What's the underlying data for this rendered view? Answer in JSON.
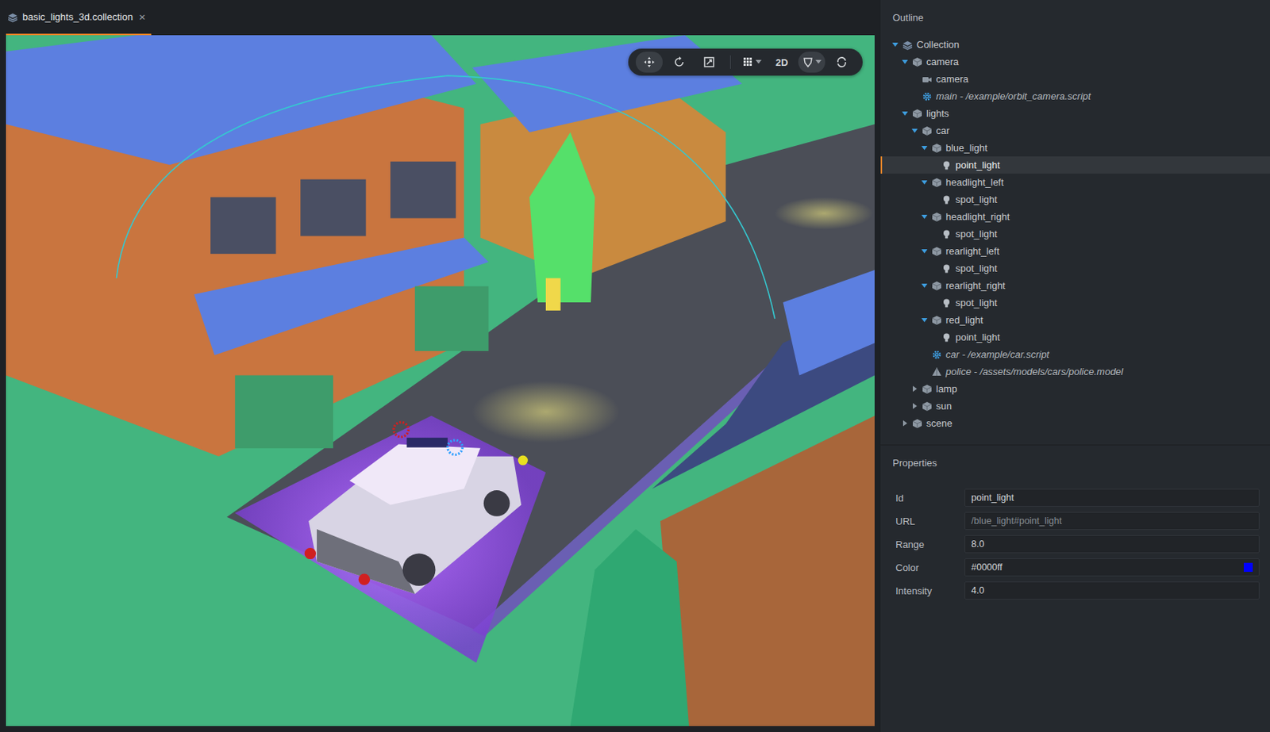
{
  "tabs": [
    {
      "label": "basic_lights_3d.collection",
      "selected": true,
      "close": "×"
    }
  ],
  "viewport": {
    "toolbar": {
      "mode_label": "2D"
    }
  },
  "outline": {
    "title": "Outline",
    "items": [
      {
        "label": "Collection",
        "kind": "collection",
        "depth": 0,
        "expandable": true,
        "expanded": true,
        "selected": false
      },
      {
        "label": "camera",
        "kind": "go",
        "depth": 1,
        "expandable": true,
        "expanded": true,
        "selected": false
      },
      {
        "label": "camera",
        "kind": "camera",
        "depth": 2,
        "expandable": false,
        "expanded": false,
        "selected": false
      },
      {
        "label": "main - /example/orbit_camera.script",
        "kind": "script",
        "depth": 2,
        "expandable": false,
        "expanded": false,
        "selected": false
      },
      {
        "label": "lights",
        "kind": "go",
        "depth": 1,
        "expandable": true,
        "expanded": true,
        "selected": false
      },
      {
        "label": "car",
        "kind": "go",
        "depth": 2,
        "expandable": true,
        "expanded": true,
        "selected": false
      },
      {
        "label": "blue_light",
        "kind": "go",
        "depth": 3,
        "expandable": true,
        "expanded": true,
        "selected": false
      },
      {
        "label": "point_light",
        "kind": "light",
        "depth": 4,
        "expandable": false,
        "expanded": false,
        "selected": true
      },
      {
        "label": "headlight_left",
        "kind": "go",
        "depth": 3,
        "expandable": true,
        "expanded": true,
        "selected": false
      },
      {
        "label": "spot_light",
        "kind": "light",
        "depth": 4,
        "expandable": false,
        "expanded": false,
        "selected": false
      },
      {
        "label": "headlight_right",
        "kind": "go",
        "depth": 3,
        "expandable": true,
        "expanded": true,
        "selected": false
      },
      {
        "label": "spot_light",
        "kind": "light",
        "depth": 4,
        "expandable": false,
        "expanded": false,
        "selected": false
      },
      {
        "label": "rearlight_left",
        "kind": "go",
        "depth": 3,
        "expandable": true,
        "expanded": true,
        "selected": false
      },
      {
        "label": "spot_light",
        "kind": "light",
        "depth": 4,
        "expandable": false,
        "expanded": false,
        "selected": false
      },
      {
        "label": "rearlight_right",
        "kind": "go",
        "depth": 3,
        "expandable": true,
        "expanded": true,
        "selected": false
      },
      {
        "label": "spot_light",
        "kind": "light",
        "depth": 4,
        "expandable": false,
        "expanded": false,
        "selected": false
      },
      {
        "label": "red_light",
        "kind": "go",
        "depth": 3,
        "expandable": true,
        "expanded": true,
        "selected": false
      },
      {
        "label": "point_light",
        "kind": "light",
        "depth": 4,
        "expandable": false,
        "expanded": false,
        "selected": false
      },
      {
        "label": "car - /example/car.script",
        "kind": "script",
        "depth": 3,
        "expandable": false,
        "expanded": false,
        "selected": false
      },
      {
        "label": "police - /assets/models/cars/police.model",
        "kind": "model",
        "depth": 3,
        "expandable": false,
        "expanded": false,
        "selected": false
      },
      {
        "label": "lamp",
        "kind": "go",
        "depth": 2,
        "expandable": true,
        "expanded": false,
        "selected": false
      },
      {
        "label": "sun",
        "kind": "go",
        "depth": 2,
        "expandable": true,
        "expanded": false,
        "selected": false
      },
      {
        "label": "scene",
        "kind": "go",
        "depth": 1,
        "expandable": true,
        "expanded": false,
        "selected": false
      }
    ]
  },
  "properties": {
    "title": "Properties",
    "fields": [
      {
        "label": "Id",
        "value": "point_light",
        "kind": "text",
        "readonly": false
      },
      {
        "label": "URL",
        "value": "/blue_light#point_light",
        "kind": "text",
        "readonly": true
      },
      {
        "label": "Range",
        "value": "8.0",
        "kind": "text",
        "readonly": false
      },
      {
        "label": "Color",
        "value": "#0000ff",
        "kind": "color",
        "readonly": false
      },
      {
        "label": "Intensity",
        "value": "4.0",
        "kind": "text",
        "readonly": false
      }
    ]
  }
}
